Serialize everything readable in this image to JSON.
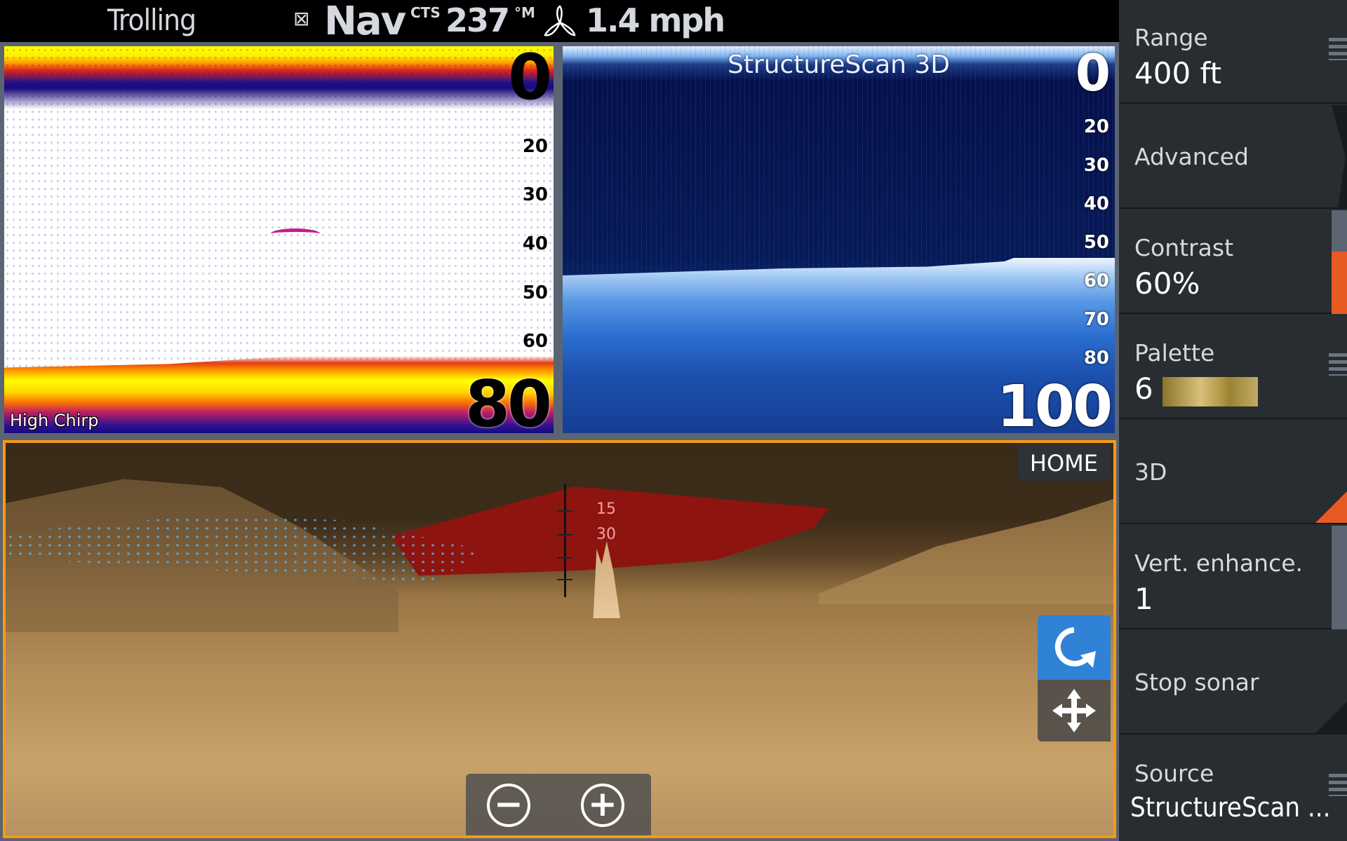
{
  "header": {
    "mode": "Trolling",
    "nav_box_icon": "checkbox-x-icon",
    "nav_label": "Nav",
    "course_prefix": "CTS",
    "course_value": "237",
    "course_unit": "°M",
    "speed_icon": "propeller-icon",
    "speed": "1.4 mph"
  },
  "panes": {
    "sonar_left": {
      "label": "High Chirp",
      "range_top": "0",
      "range_bottom": "80",
      "depth_ticks": [
        "20",
        "30",
        "40",
        "50",
        "60"
      ]
    },
    "sonar_right": {
      "title": "StructureScan 3D",
      "range_top": "0",
      "range_bottom": "100",
      "depth_ticks": [
        "20",
        "30",
        "40",
        "50",
        "60",
        "70",
        "80"
      ]
    },
    "view3d": {
      "home_label": "HOME",
      "depth_labels": [
        "15",
        "30"
      ],
      "rotate_icon": "rotate-icon",
      "pan_icon": "pan-move-icon",
      "zoom_out_label": "−",
      "zoom_in_label": "+"
    }
  },
  "sidebar": {
    "items": [
      {
        "label": "Range",
        "value": "400 ft",
        "control": "menu"
      },
      {
        "label": "Advanced",
        "value": "",
        "control": "submenu"
      },
      {
        "label": "Contrast",
        "value": "60%",
        "control": "slider",
        "level_percent": 60
      },
      {
        "label": "Palette",
        "value": "6",
        "control": "menu"
      },
      {
        "label": "3D",
        "value": "",
        "control": "toggle-on"
      },
      {
        "label": "Vert. enhance.",
        "value": "1",
        "control": "slider"
      },
      {
        "label": "Stop sonar",
        "value": "",
        "control": "toggle-off"
      },
      {
        "label": "Source",
        "value": "StructureScan ...",
        "control": "menu"
      }
    ]
  },
  "colors": {
    "accent_orange": "#e85a24",
    "active_border": "#f59a16",
    "button_blue": "#2f82d6",
    "sidebar_bg": "#272d31"
  }
}
